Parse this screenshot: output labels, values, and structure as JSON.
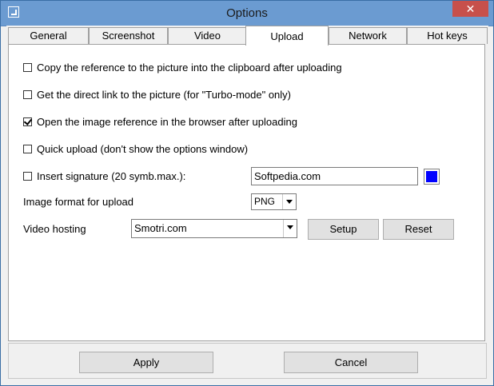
{
  "window": {
    "title": "Options",
    "close_glyph": "✕",
    "app_icon": "app-window-icon"
  },
  "tabs": [
    {
      "label": "General",
      "active": false
    },
    {
      "label": "Screenshot",
      "active": false
    },
    {
      "label": "Video",
      "active": false
    },
    {
      "label": "Upload",
      "active": true
    },
    {
      "label": "Network",
      "active": false
    },
    {
      "label": "Hot keys",
      "active": false
    }
  ],
  "upload": {
    "copy_reference": {
      "label": "Copy the reference to the picture into the clipboard after uploading",
      "checked": false
    },
    "direct_link": {
      "label": "Get the direct link to the picture (for \"Turbo-mode\" only)",
      "checked": false
    },
    "open_in_browser": {
      "label": "Open the image reference in the browser after uploading",
      "checked": true
    },
    "quick_upload": {
      "label": "Quick upload (don't show the options window)",
      "checked": false
    },
    "signature": {
      "label": "Insert signature  (20 symb.max.):",
      "checked": false,
      "value": "Softpedia.com",
      "color": "#0000ff"
    },
    "image_format": {
      "label": "Image format for upload",
      "value": "PNG"
    },
    "video_hosting": {
      "label": "Video hosting",
      "value": "Smotri.com",
      "setup_label": "Setup",
      "reset_label": "Reset"
    }
  },
  "footer": {
    "apply_label": "Apply",
    "cancel_label": "Cancel"
  }
}
